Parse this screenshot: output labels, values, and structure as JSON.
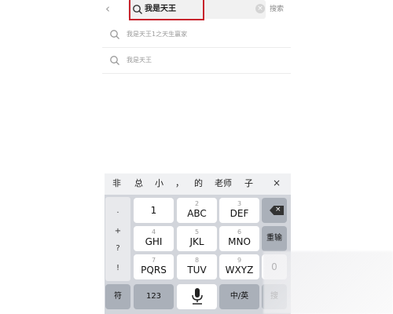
{
  "search_bar": {
    "back_icon": "chevron-left-icon",
    "query": "我是天王",
    "search_button": "搜索",
    "highlight_color": "#c8232c"
  },
  "suggestions": [
    {
      "text": "我是天王1之天生赢家"
    },
    {
      "text": "我是天王"
    }
  ],
  "keyboard": {
    "candidates": [
      "非",
      "总",
      "小",
      "，",
      "的",
      "老师",
      "子"
    ],
    "close": "×",
    "punctuation": [
      ".",
      "+",
      "?",
      "!"
    ],
    "rows": [
      [
        {
          "sub": "",
          "main": "1"
        },
        {
          "sub": "2",
          "main": "ABC"
        },
        {
          "sub": "3",
          "main": "DEF"
        }
      ],
      [
        {
          "sub": "4",
          "main": "GHI"
        },
        {
          "sub": "5",
          "main": "JKL"
        },
        {
          "sub": "6",
          "main": "MNO"
        }
      ],
      [
        {
          "sub": "7",
          "main": "PQRS"
        },
        {
          "sub": "8",
          "main": "TUV"
        },
        {
          "sub": "9",
          "main": "WXYZ"
        }
      ]
    ],
    "reenter": "重输",
    "zero": "0",
    "symbol": "符",
    "num": "123",
    "lang": "中/英",
    "search": "搜"
  }
}
